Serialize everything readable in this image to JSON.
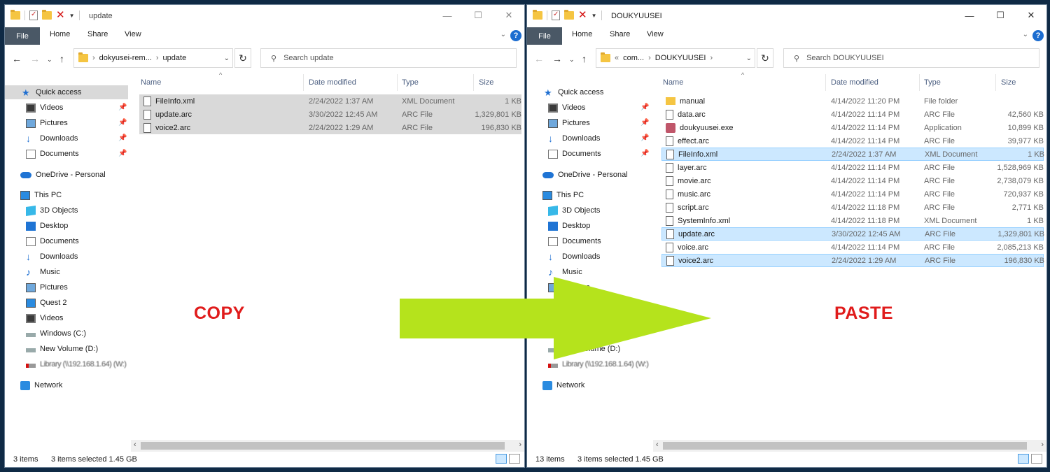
{
  "colors": {
    "accent": "#1f6fd1",
    "overlay_text": "#e01b1b",
    "arrow": "#b5e31c",
    "selected_blue": "#cce8ff",
    "selected_grey": "#d9d9d9"
  },
  "left": {
    "title": "update",
    "ribbon": {
      "file": "File",
      "home": "Home",
      "share": "Share",
      "view": "View"
    },
    "address": {
      "part1": "dokyusei-rem...",
      "part2": "update"
    },
    "search_placeholder": "Search update",
    "headers": {
      "name": "Name",
      "date": "Date modified",
      "type": "Type",
      "size": "Size"
    },
    "files": [
      {
        "name": "FileInfo.xml",
        "date": "2/24/2022 1:37 AM",
        "type": "XML Document",
        "size": "1 KB"
      },
      {
        "name": "update.arc",
        "date": "3/30/2022 12:45 AM",
        "type": "ARC File",
        "size": "1,329,801 KB"
      },
      {
        "name": "voice2.arc",
        "date": "2/24/2022 1:29 AM",
        "type": "ARC File",
        "size": "196,830 KB"
      }
    ],
    "status": {
      "count": "3 items",
      "selected": "3 items selected  1.45 GB"
    }
  },
  "right": {
    "title": "DOUKYUUSEI",
    "ribbon": {
      "file": "File",
      "home": "Home",
      "share": "Share",
      "view": "View"
    },
    "address": {
      "prefix": "«",
      "part1": "com...",
      "part2": "DOUKYUUSEI"
    },
    "search_placeholder": "Search DOUKYUUSEI",
    "headers": {
      "name": "Name",
      "date": "Date modified",
      "type": "Type",
      "size": "Size"
    },
    "files": [
      {
        "name": "manual",
        "date": "4/14/2022 11:20 PM",
        "type": "File folder",
        "size": ""
      },
      {
        "name": "data.arc",
        "date": "4/14/2022 11:14 PM",
        "type": "ARC File",
        "size": "42,560 KB"
      },
      {
        "name": "doukyuusei.exe",
        "date": "4/14/2022 11:14 PM",
        "type": "Application",
        "size": "10,899 KB"
      },
      {
        "name": "effect.arc",
        "date": "4/14/2022 11:14 PM",
        "type": "ARC File",
        "size": "39,977 KB"
      },
      {
        "name": "FileInfo.xml",
        "date": "2/24/2022 1:37 AM",
        "type": "XML Document",
        "size": "1 KB"
      },
      {
        "name": "layer.arc",
        "date": "4/14/2022 11:14 PM",
        "type": "ARC File",
        "size": "1,528,969 KB"
      },
      {
        "name": "movie.arc",
        "date": "4/14/2022 11:14 PM",
        "type": "ARC File",
        "size": "2,738,079 KB"
      },
      {
        "name": "music.arc",
        "date": "4/14/2022 11:14 PM",
        "type": "ARC File",
        "size": "720,937 KB"
      },
      {
        "name": "script.arc",
        "date": "4/14/2022 11:18 PM",
        "type": "ARC File",
        "size": "2,771 KB"
      },
      {
        "name": "SystemInfo.xml",
        "date": "4/14/2022 11:18 PM",
        "type": "XML Document",
        "size": "1 KB"
      },
      {
        "name": "update.arc",
        "date": "3/30/2022 12:45 AM",
        "type": "ARC File",
        "size": "1,329,801 KB"
      },
      {
        "name": "voice.arc",
        "date": "4/14/2022 11:14 PM",
        "type": "ARC File",
        "size": "2,085,213 KB"
      },
      {
        "name": "voice2.arc",
        "date": "2/24/2022 1:29 AM",
        "type": "ARC File",
        "size": "196,830 KB"
      }
    ],
    "status": {
      "count": "13 items",
      "selected": "3 items selected  1.45 GB"
    }
  },
  "navpane": {
    "quick_access": "Quick access",
    "qa_items": [
      "Videos",
      "Pictures",
      "Downloads",
      "Documents"
    ],
    "onedrive": "OneDrive - Personal",
    "this_pc": "This PC",
    "pc_items": [
      "3D Objects",
      "Desktop",
      "Documents",
      "Downloads",
      "Music",
      "Pictures",
      "Quest 2",
      "Videos",
      "Windows (C:)",
      "New Volume (D:)"
    ],
    "library": "Library (\\\\192.168.1.64) (W:)",
    "network": "Network"
  },
  "overlay": {
    "copy": "COPY",
    "paste": "PASTE"
  }
}
